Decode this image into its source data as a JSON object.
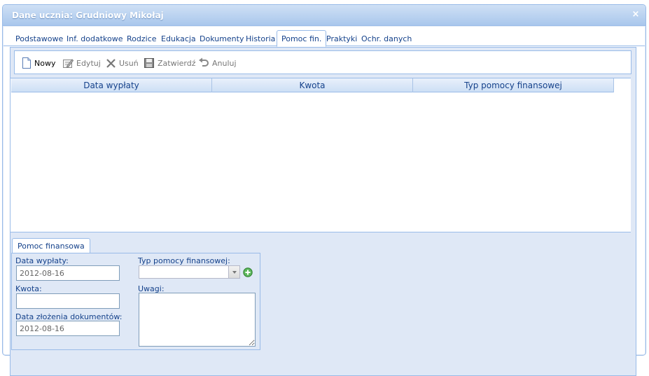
{
  "window": {
    "title": "Dane ucznia: Grudniowy Mikołaj",
    "close_glyph": "×"
  },
  "tabs": [
    {
      "label": "Podstawowe"
    },
    {
      "label": "Inf. dodatkowe"
    },
    {
      "label": "Rodzice"
    },
    {
      "label": "Edukacja"
    },
    {
      "label": "Dokumenty"
    },
    {
      "label": "Historia"
    },
    {
      "label": "Pomoc fin.",
      "active": true
    },
    {
      "label": "Praktyki"
    },
    {
      "label": "Ochr. danych"
    }
  ],
  "toolbar": {
    "new_label": "Nowy",
    "edit_label": "Edytuj",
    "delete_label": "Usuń",
    "confirm_label": "Zatwierdź",
    "cancel_label": "Anuluj"
  },
  "grid": {
    "columns": [
      "Data wypłaty",
      "Kwota",
      "Typ pomocy finansowej"
    ],
    "rows": []
  },
  "form": {
    "tab_label": "Pomoc finansowa",
    "payout_date_label": "Data wypłaty:",
    "payout_date_value": "2012-08-16",
    "amount_label": "Kwota:",
    "amount_value": "",
    "docs_date_label": "Data złożenia dokumentów:",
    "docs_date_value": "2012-08-16",
    "aid_type_label": "Typ pomocy finansowej:",
    "aid_type_value": "",
    "notes_label": "Uwagi:",
    "notes_value": ""
  },
  "colors": {
    "border": "#99bbe8",
    "panel_bg": "#dfe8f6",
    "text": "#15428b"
  }
}
